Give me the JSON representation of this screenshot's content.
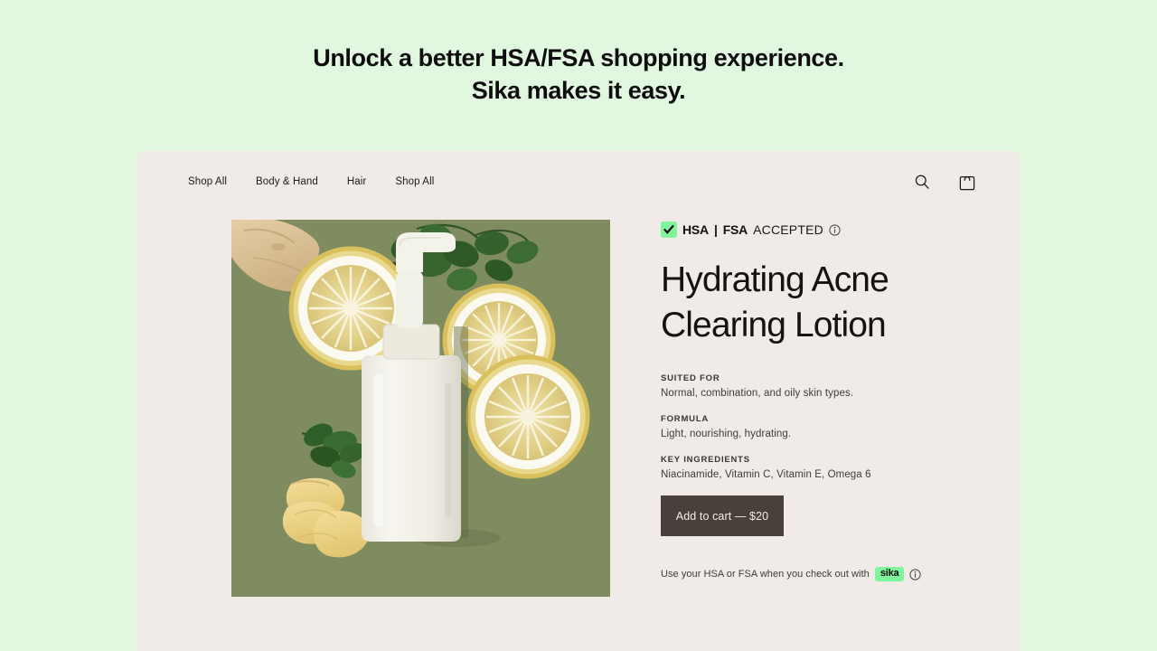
{
  "hero": {
    "line1": "Unlock a better HSA/FSA shopping experience.",
    "line2": "Sika makes it easy."
  },
  "nav": {
    "links": [
      {
        "label": "Shop All"
      },
      {
        "label": "Body & Hand"
      },
      {
        "label": "Hair"
      },
      {
        "label": "Shop All"
      }
    ],
    "icons": {
      "search": "search-icon",
      "cart": "shopping-bag-icon"
    }
  },
  "product": {
    "badge": {
      "check": "✔",
      "hsa": "HSA",
      "separator": "|",
      "fsa": "FSA",
      "accepted": "ACCEPTED",
      "info": "info-icon"
    },
    "title": "Hydrating Acne Clearing Lotion",
    "specs": [
      {
        "label": "SUITED FOR",
        "value": "Normal, combination, and oily skin types."
      },
      {
        "label": "FORMULA",
        "value": "Light, nourishing, hydrating."
      },
      {
        "label": "KEY INGREDIENTS",
        "value": "Niacinamide, Vitamin C, Vitamin E, Omega 6"
      }
    ],
    "add_to_cart": "Add to cart — $20",
    "price": "$20",
    "checkout_note": "Use your HSA or FSA when you check out with",
    "sika_chip": "sika",
    "image_alt": "Flat lay of white pump lotion bottle with lemon slices, ginger root and mint leaves on olive green background"
  },
  "colors": {
    "page_background": "#e1f7e0",
    "card_background": "#f0ebe7",
    "accent_green": "#7ef59a",
    "button_brown": "#4a403b",
    "photo_background": "#7d8a5f"
  }
}
